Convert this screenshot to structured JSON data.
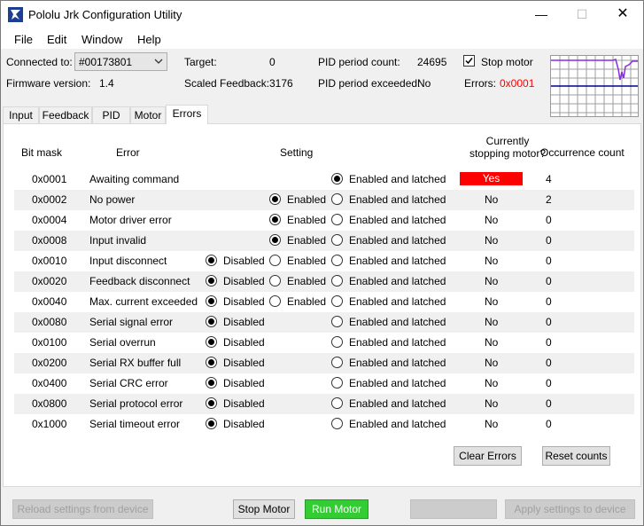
{
  "window": {
    "title": "Pololu Jrk Configuration Utility",
    "controls": {
      "minimize": "—",
      "maximize": "☐",
      "close": "✕"
    }
  },
  "menu": [
    "File",
    "Edit",
    "Window",
    "Help"
  ],
  "status": {
    "connected_label": "Connected to:",
    "device": "#00173801",
    "firmware_label": "Firmware version:",
    "firmware_value": "1.4",
    "target_label": "Target:",
    "target_value": "0",
    "scaled_feedback_label": "Scaled Feedback:",
    "scaled_feedback_value": "3176",
    "pid_count_label": "PID period count:",
    "pid_count_value": "24695",
    "pid_exceeded_label": "PID period exceeded:",
    "pid_exceeded_value": "No",
    "stop_motor_label": "Stop motor",
    "stop_motor_checked": true,
    "errors_label": "Errors:",
    "errors_value": "0x0001"
  },
  "tabs": [
    "Input",
    "Feedback",
    "PID",
    "Motor",
    "Errors"
  ],
  "active_tab": "Errors",
  "table": {
    "headers": {
      "bit_mask": "Bit mask",
      "error": "Error",
      "setting": "Setting",
      "currently_line1": "Currently",
      "currently_line2": "stopping motor?",
      "occurrence": "Occurrence count"
    },
    "option_labels": {
      "disabled": "Disabled",
      "enabled": "Enabled",
      "latched": "Enabled and latched"
    },
    "rows": [
      {
        "mask": "0x0001",
        "name": "Awaiting command",
        "options": [
          "latched"
        ],
        "selected": "latched",
        "stopping": "Yes",
        "count": "4"
      },
      {
        "mask": "0x0002",
        "name": "No power",
        "options": [
          "enabled",
          "latched"
        ],
        "selected": "enabled",
        "stopping": "No",
        "count": "2"
      },
      {
        "mask": "0x0004",
        "name": "Motor driver error",
        "options": [
          "enabled",
          "latched"
        ],
        "selected": "enabled",
        "stopping": "No",
        "count": "0"
      },
      {
        "mask": "0x0008",
        "name": "Input invalid",
        "options": [
          "enabled",
          "latched"
        ],
        "selected": "enabled",
        "stopping": "No",
        "count": "0"
      },
      {
        "mask": "0x0010",
        "name": "Input disconnect",
        "options": [
          "disabled",
          "enabled",
          "latched"
        ],
        "selected": "disabled",
        "stopping": "No",
        "count": "0"
      },
      {
        "mask": "0x0020",
        "name": "Feedback disconnect",
        "options": [
          "disabled",
          "enabled",
          "latched"
        ],
        "selected": "disabled",
        "stopping": "No",
        "count": "0"
      },
      {
        "mask": "0x0040",
        "name": "Max. current exceeded",
        "options": [
          "disabled",
          "enabled",
          "latched"
        ],
        "selected": "disabled",
        "stopping": "No",
        "count": "0"
      },
      {
        "mask": "0x0080",
        "name": "Serial signal error",
        "options": [
          "disabled",
          "latched"
        ],
        "selected": "disabled",
        "stopping": "No",
        "count": "0"
      },
      {
        "mask": "0x0100",
        "name": "Serial overrun",
        "options": [
          "disabled",
          "latched"
        ],
        "selected": "disabled",
        "stopping": "No",
        "count": "0"
      },
      {
        "mask": "0x0200",
        "name": "Serial RX buffer full",
        "options": [
          "disabled",
          "latched"
        ],
        "selected": "disabled",
        "stopping": "No",
        "count": "0"
      },
      {
        "mask": "0x0400",
        "name": "Serial CRC error",
        "options": [
          "disabled",
          "latched"
        ],
        "selected": "disabled",
        "stopping": "No",
        "count": "0"
      },
      {
        "mask": "0x0800",
        "name": "Serial protocol error",
        "options": [
          "disabled",
          "latched"
        ],
        "selected": "disabled",
        "stopping": "No",
        "count": "0"
      },
      {
        "mask": "0x1000",
        "name": "Serial timeout error",
        "options": [
          "disabled",
          "latched"
        ],
        "selected": "disabled",
        "stopping": "No",
        "count": "0"
      }
    ]
  },
  "buttons": {
    "clear_errors": "Clear Errors",
    "reset_counts": "Reset counts",
    "reload": "Reload settings from device",
    "stop_motor": "Stop Motor",
    "run_motor": "Run Motor",
    "blank": "",
    "apply": "Apply settings to device"
  },
  "colors": {
    "error_red": "#ff0000",
    "run_green": "#32cd32",
    "graph_purple": "#8a2be2",
    "graph_blue": "#00008b"
  }
}
